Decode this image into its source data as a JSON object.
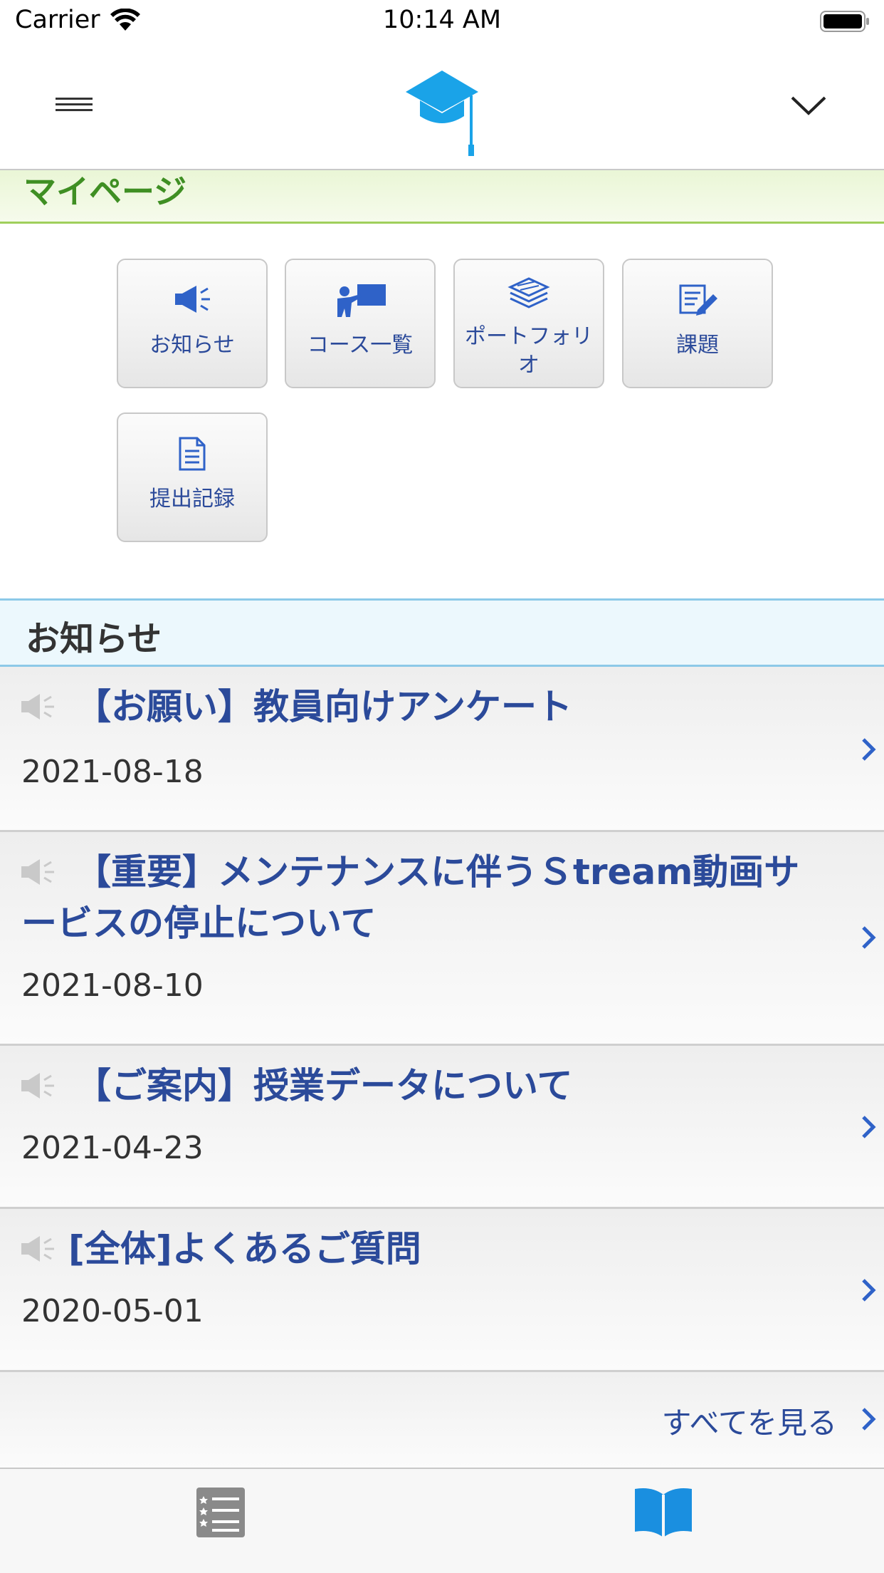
{
  "status_bar": {
    "carrier": "Carrier",
    "time": "10:14 AM"
  },
  "nav_bar": {
    "menu_icon": "hamburger-menu-icon",
    "logo_icon": "graduation-cap-icon",
    "dropdown_icon": "chevron-down-icon",
    "logo_color": "#1aa3e8"
  },
  "mypage": {
    "title": "マイページ",
    "title_color": "#3f8f23"
  },
  "tiles": [
    {
      "label": "お知らせ",
      "icon": "megaphone-icon"
    },
    {
      "label": "コース一覧",
      "icon": "teacher-board-icon"
    },
    {
      "label": "ポートフォリオ",
      "icon": "stacked-layers-icon"
    },
    {
      "label": "課題",
      "icon": "edit-document-icon"
    },
    {
      "label": "提出記録",
      "icon": "document-icon"
    }
  ],
  "notices": {
    "header": "お知らせ",
    "items": [
      {
        "title": "【お願い】教員向けアンケート",
        "date": "2021-08-18"
      },
      {
        "title": "【重要】メンテナンスに伴うＳtream動画サービスの停止について",
        "date": "2021-08-10"
      },
      {
        "title": "【ご案内】授業データについて",
        "date": "2021-04-23"
      },
      {
        "title": "[全体]よくあるご質問",
        "date": "2020-05-01"
      }
    ],
    "see_all": "すべてを見る",
    "link_color": "#2b4a9a"
  },
  "tab_bar": {
    "tabs": [
      {
        "icon": "list-icon",
        "selected": false
      },
      {
        "icon": "open-book-icon",
        "selected": true
      }
    ],
    "accent": "#1a8fe0"
  }
}
